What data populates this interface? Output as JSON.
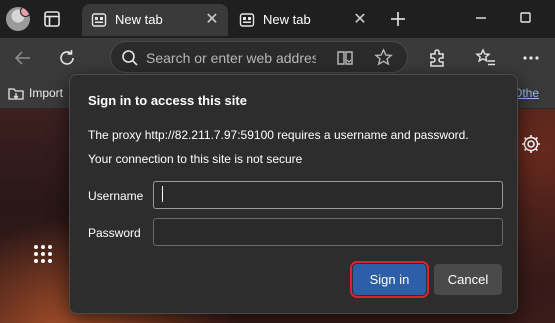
{
  "tabs": [
    {
      "label": "New tab",
      "active": true
    },
    {
      "label": "New tab",
      "active": false
    }
  ],
  "address_bar": {
    "placeholder": "Search or enter web address"
  },
  "favorites_bar": {
    "import_label": "Import",
    "other_label": "Othe"
  },
  "dialog": {
    "title": "Sign in to access this site",
    "message": "The proxy http://82.211.7.97:59100 requires a username and password.",
    "warning": "Your connection to this site is not secure",
    "username_label": "Username",
    "username_value": "",
    "password_label": "Password",
    "password_value": "",
    "sign_in_label": "Sign in",
    "cancel_label": "Cancel"
  },
  "colors": {
    "primary_button": "#2d5ea8",
    "highlight_outline": "#e0202a",
    "dialog_bg": "#2d2d2d",
    "toolbar_bg": "#3a3a3a"
  }
}
